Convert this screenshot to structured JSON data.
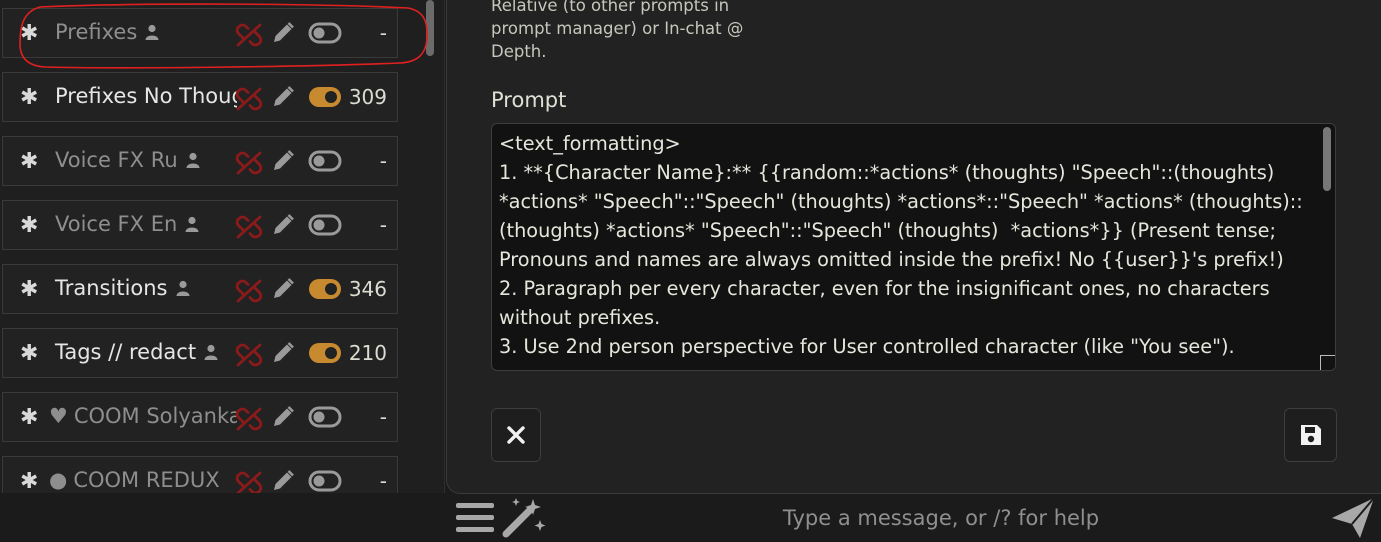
{
  "prompt_list": {
    "items": [
      {
        "icon": "",
        "name": "Prefixes",
        "has_person_icon": true,
        "enabled": false,
        "count": "-"
      },
      {
        "icon": "",
        "name": "Prefixes No Thoughts",
        "has_person_icon": false,
        "enabled": true,
        "count": "309"
      },
      {
        "icon": "",
        "name": "Voice FX Ru",
        "has_person_icon": true,
        "enabled": false,
        "count": "-"
      },
      {
        "icon": "",
        "name": "Voice FX En",
        "has_person_icon": true,
        "enabled": false,
        "count": "-"
      },
      {
        "icon": "",
        "name": "Transitions",
        "has_person_icon": true,
        "enabled": true,
        "count": "346"
      },
      {
        "icon": "",
        "name": "Tags // redact",
        "has_person_icon": true,
        "enabled": true,
        "count": "210"
      },
      {
        "icon": "♥",
        "name": "COOM Solyanka",
        "has_person_icon": false,
        "enabled": false,
        "count": "-"
      },
      {
        "icon": "●",
        "name": "COOM REDUX",
        "has_person_icon": false,
        "enabled": false,
        "count": "-"
      }
    ]
  },
  "editor": {
    "position_hint": "Relative (to other prompts in prompt manager) or In-chat @ Depth.",
    "prompt_label": "Prompt",
    "prompt_text": "<text_formatting>\n1. **{Character Name}:** {{random::*actions* (thoughts) \"Speech\"::(thoughts) *actions* \"Speech\"::\"Speech\" (thoughts) *actions*::\"Speech\" *actions* (thoughts)::(thoughts) *actions* \"Speech\"::\"Speech\" (thoughts)  *actions*}} (Present tense; Pronouns and names are always omitted inside the prefix! No {{user}}'s prefix!)\n2. Paragraph per every character, even for the insignificant ones, no characters without prefixes.\n3. Use 2nd person perspective for User controlled character (like \"You see\")."
  },
  "chat_bar": {
    "placeholder": "Type a message, or /? for help"
  },
  "colors": {
    "unlink_red": "#8b1a1a",
    "toggle_on": "#c78a2e",
    "highlight_red": "#e02020"
  }
}
